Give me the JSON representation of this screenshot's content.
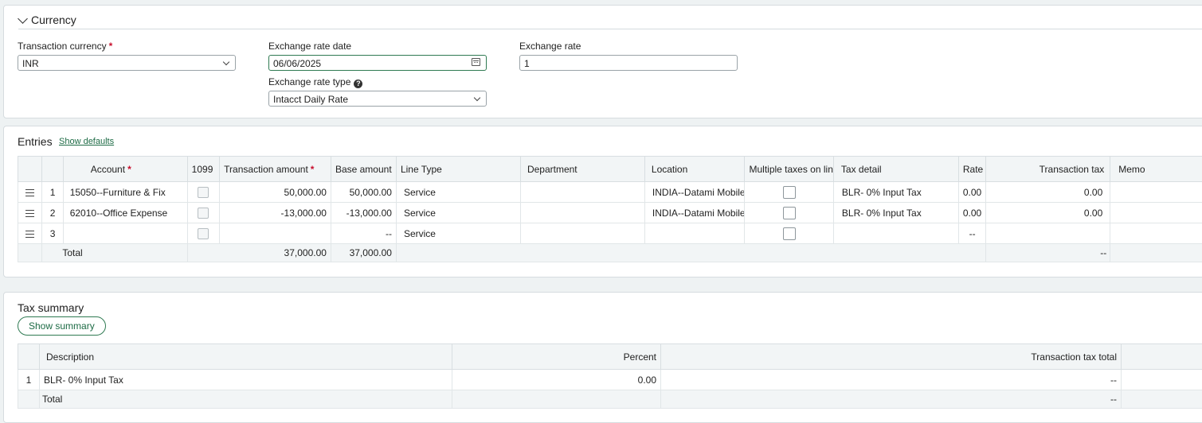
{
  "currency": {
    "title": "Currency",
    "transaction_currency": {
      "label": "Transaction currency",
      "required": "*",
      "value": "INR"
    },
    "exchange_rate_date": {
      "label": "Exchange rate date",
      "value": "06/06/2025"
    },
    "exchange_rate": {
      "label": "Exchange rate",
      "value": "1"
    },
    "exchange_rate_type": {
      "label": "Exchange rate type",
      "value": "Intacct Daily Rate"
    }
  },
  "entries": {
    "title": "Entries",
    "show_defaults": "Show defaults",
    "required_mark": "*",
    "columns": {
      "account": "Account",
      "c1099": "1099",
      "transaction_amount": "Transaction amount",
      "base_amount": "Base amount",
      "line_type": "Line Type",
      "department": "Department",
      "location": "Location",
      "multiple_taxes": "Multiple taxes on line",
      "tax_detail": "Tax detail",
      "rate": "Rate",
      "transaction_tax": "Transaction tax",
      "memo": "Memo"
    },
    "rows": [
      {
        "num": "1",
        "account": "15050--Furniture & Fix",
        "transaction_amount": "50,000.00",
        "base_amount": "50,000.00",
        "line_type": "Service",
        "department": "",
        "location": "INDIA--Datami Mobile",
        "tax_detail": "BLR- 0% Input Tax",
        "rate": "0.00",
        "transaction_tax": "0.00",
        "memo": ""
      },
      {
        "num": "2",
        "account": "62010--Office Expense",
        "transaction_amount": "-13,000.00",
        "base_amount": "-13,000.00",
        "line_type": "Service",
        "department": "",
        "location": "INDIA--Datami Mobile",
        "tax_detail": "BLR- 0% Input Tax",
        "rate": "0.00",
        "transaction_tax": "0.00",
        "memo": ""
      },
      {
        "num": "3",
        "account": "",
        "transaction_amount": "",
        "base_amount": "--",
        "line_type": "Service",
        "department": "",
        "location": "",
        "tax_detail": "",
        "rate": "--",
        "transaction_tax": "",
        "memo": ""
      }
    ],
    "total": {
      "label": "Total",
      "transaction_amount": "37,000.00",
      "base_amount": "37,000.00",
      "transaction_tax": "--"
    }
  },
  "tax_summary": {
    "title": "Tax summary",
    "show_summary": "Show summary",
    "columns": {
      "description": "Description",
      "percent": "Percent",
      "transaction_tax_total": "Transaction tax total"
    },
    "rows": [
      {
        "num": "1",
        "description": "BLR- 0% Input Tax",
        "percent": "0.00",
        "transaction_tax_total": "--"
      }
    ],
    "total": {
      "label": "Total",
      "transaction_tax_total": "--"
    }
  }
}
